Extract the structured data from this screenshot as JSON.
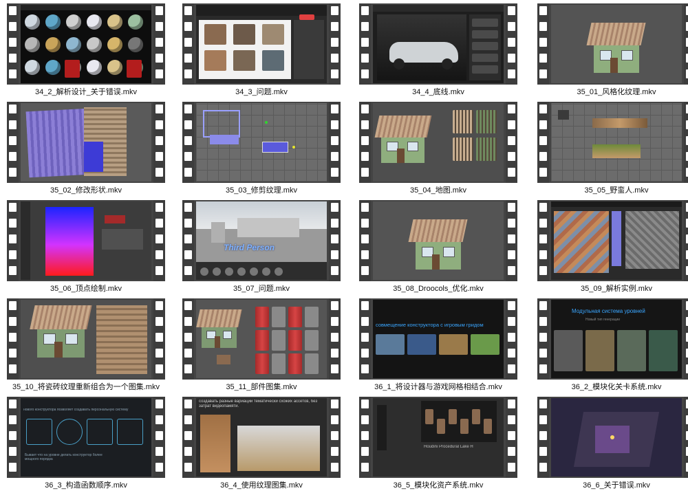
{
  "gallery": {
    "items": [
      {
        "label": "34_2_解析设计_关于错误.mkv",
        "scene": "jewelry"
      },
      {
        "label": "34_3_问题.mkv",
        "scene": "browser"
      },
      {
        "label": "34_4_底线.mkv",
        "scene": "car"
      },
      {
        "label": "35_01_风格化纹理.mkv",
        "scene": "house"
      },
      {
        "label": "35_02_修改形状.mkv",
        "scene": "texture"
      },
      {
        "label": "35_03_修剪纹理.mkv",
        "scene": "wire"
      },
      {
        "label": "35_04_地图.mkv",
        "scene": "house2"
      },
      {
        "label": "35_05_野蛮人.mkv",
        "scene": "strips"
      },
      {
        "label": "35_06_顶点绘制.mkv",
        "scene": "gradient"
      },
      {
        "label": "35_07_问题.mkv",
        "scene": "thirdperson"
      },
      {
        "label": "35_08_Droocols_优化.mkv",
        "scene": "house"
      },
      {
        "label": "35_09_解析实例.mkv",
        "scene": "atlas"
      },
      {
        "label": "35_10_将瓷砖纹理重新组合为一个图集.mkv",
        "scene": "house3"
      },
      {
        "label": "35_11_部件图集.mkv",
        "scene": "barrels"
      },
      {
        "label": "36_1_将设计器与游戏网格相结合.mkv",
        "scene": "slides"
      },
      {
        "label": "36_2_模块化关卡系统.mkv",
        "scene": "modular"
      },
      {
        "label": "36_3_构造函数顺序.mkv",
        "scene": "blueprint"
      },
      {
        "label": "36_4_使用纹理图集.mkv",
        "scene": "ruins"
      },
      {
        "label": "36_5_模块化资产系统.mkv",
        "scene": "lake"
      },
      {
        "label": "36_6_关于错误.mkv",
        "scene": "interior"
      }
    ]
  },
  "overlays": {
    "third_person": "Third Person",
    "slide_36_1": "совмещение конструктора с игровым гридом",
    "slide_36_2": "Модульная система уровней",
    "slide_36_2_sub": "Новый тип генерации",
    "slide_36_3_top": "нового конструктора позволяет создавать персональную систему",
    "slide_36_3_bottom": "Бывает что на уровне делать конструктор более мощного порядка",
    "slide_36_4": "создавать разные вариации тематически схожих ассетов, без затрат видеопамяти.",
    "slide_36_5": "Houdini Procedural Lake H"
  }
}
